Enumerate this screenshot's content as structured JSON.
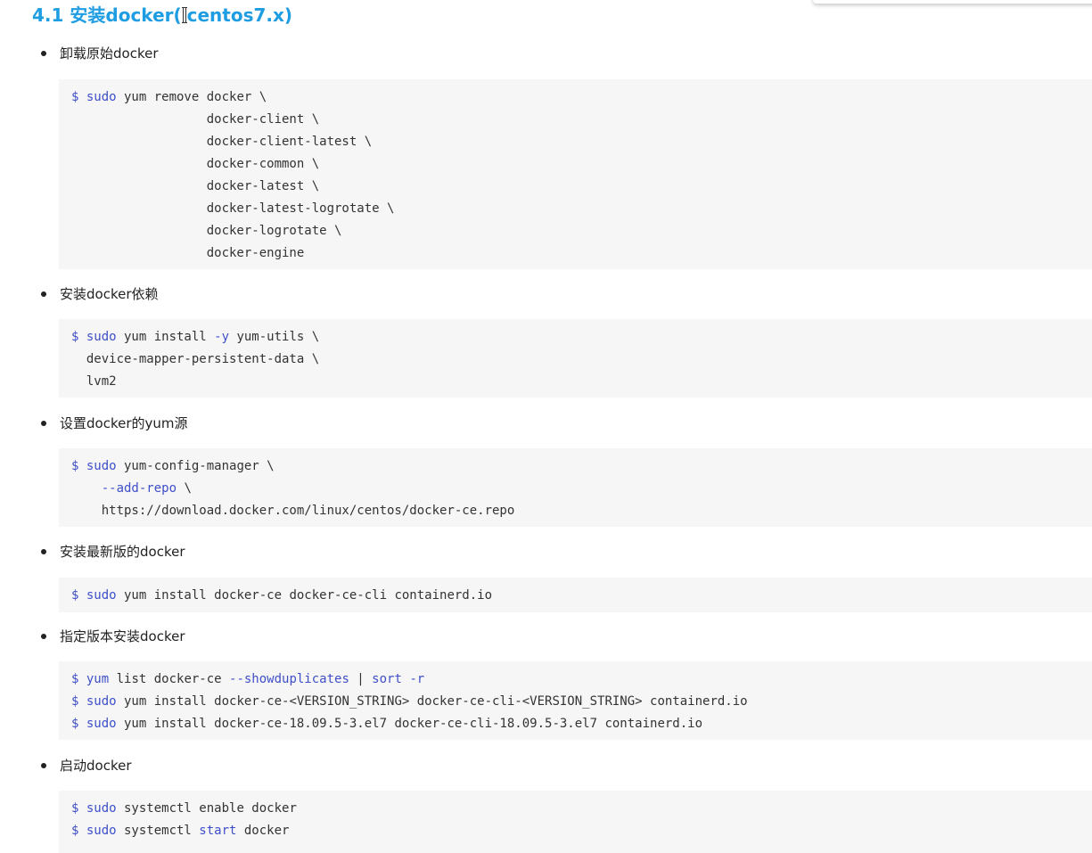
{
  "heading": {
    "before_cursor": "4.1 安装docker(",
    "after_cursor": "centos7.x)"
  },
  "sections": [
    {
      "label": "卸载原始docker",
      "code": [
        [
          {
            "t": "$ ",
            "c": "kw"
          },
          {
            "t": "sudo",
            "c": "kw"
          },
          {
            "t": " yum remove docker \\"
          }
        ],
        [
          {
            "t": "                  docker-client \\"
          }
        ],
        [
          {
            "t": "                  docker-client-latest \\"
          }
        ],
        [
          {
            "t": "                  docker-common \\"
          }
        ],
        [
          {
            "t": "                  docker-latest \\"
          }
        ],
        [
          {
            "t": "                  docker-latest-logrotate \\"
          }
        ],
        [
          {
            "t": "                  docker-logrotate \\"
          }
        ],
        [
          {
            "t": "                  docker-engine"
          }
        ]
      ]
    },
    {
      "label": "安装docker依赖",
      "code": [
        [
          {
            "t": "$ ",
            "c": "kw"
          },
          {
            "t": "sudo",
            "c": "kw"
          },
          {
            "t": " yum install "
          },
          {
            "t": "-y",
            "c": "kw"
          },
          {
            "t": " yum-utils \\"
          }
        ],
        [
          {
            "t": "  device-mapper-persistent-data \\"
          }
        ],
        [
          {
            "t": "  lvm2"
          }
        ]
      ]
    },
    {
      "label": "设置docker的yum源",
      "code": [
        [
          {
            "t": "$ ",
            "c": "kw"
          },
          {
            "t": "sudo",
            "c": "kw"
          },
          {
            "t": " yum-config-manager \\"
          }
        ],
        [
          {
            "t": "    "
          },
          {
            "t": "--add-repo",
            "c": "kw"
          },
          {
            "t": " \\"
          }
        ],
        [
          {
            "t": "    https://download.docker.com/linux/centos/docker-ce.repo"
          }
        ]
      ]
    },
    {
      "label": "安装最新版的docker",
      "code": [
        [
          {
            "t": "$ ",
            "c": "kw"
          },
          {
            "t": "sudo",
            "c": "kw"
          },
          {
            "t": " yum install docker-ce docker-ce-cli containerd.io"
          }
        ]
      ]
    },
    {
      "label": "指定版本安装docker",
      "code": [
        [
          {
            "t": "$ ",
            "c": "kw"
          },
          {
            "t": "yum",
            "c": "kw"
          },
          {
            "t": " list docker-ce "
          },
          {
            "t": "--showduplicates",
            "c": "kw"
          },
          {
            "t": " | "
          },
          {
            "t": "sort",
            "c": "kw"
          },
          {
            "t": " "
          },
          {
            "t": "-r",
            "c": "kw"
          }
        ],
        [
          {
            "t": "$ ",
            "c": "kw"
          },
          {
            "t": "sudo",
            "c": "kw"
          },
          {
            "t": " yum install docker-ce-<VERSION_STRING> docker-ce-cli-<VERSION_STRING> containerd.io"
          }
        ],
        [
          {
            "t": "$ ",
            "c": "kw"
          },
          {
            "t": "sudo",
            "c": "kw"
          },
          {
            "t": " yum install docker-ce-18.09.5-3.el7 docker-ce-cli-18.09.5-3.el7 containerd.io"
          }
        ]
      ]
    },
    {
      "label": "启动docker",
      "code": [
        [
          {
            "t": "$ ",
            "c": "kw"
          },
          {
            "t": "sudo",
            "c": "kw"
          },
          {
            "t": " systemctl enable docker"
          }
        ],
        [
          {
            "t": "$ ",
            "c": "kw"
          },
          {
            "t": "sudo",
            "c": "kw"
          },
          {
            "t": " systemctl "
          },
          {
            "t": "start",
            "c": "kw"
          },
          {
            "t": " docker"
          }
        ]
      ]
    }
  ]
}
